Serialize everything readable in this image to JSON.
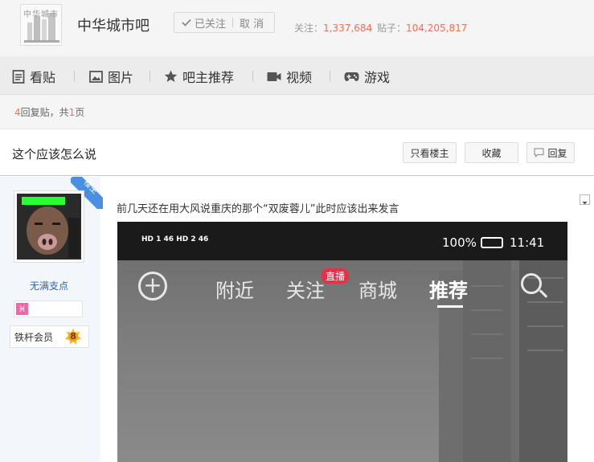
{
  "forum": {
    "logo_text": "中华城市",
    "name": "中华城市吧",
    "followed_label": "已关注",
    "unfollow_label": "取 消",
    "follow_label": "关注：",
    "follow_count": "1,337,684",
    "posts_label": "贴子：",
    "posts_count": "104,205,817"
  },
  "nav": [
    {
      "label": "看贴",
      "icon": "document-icon"
    },
    {
      "label": "图片",
      "icon": "image-icon"
    },
    {
      "label": "吧主推荐",
      "icon": "star-icon"
    },
    {
      "label": "视频",
      "icon": "video-camera-icon"
    },
    {
      "label": "游戏",
      "icon": "gamepad-icon"
    }
  ],
  "reply_info": {
    "count": "4",
    "text1": "回复贴，共",
    "pages": "1",
    "text2": "页"
  },
  "thread": {
    "title": "这个应该怎么说",
    "only_op_label": "只看楼主",
    "favorite_label": "收藏",
    "reply_label": "回复"
  },
  "author": {
    "badge": "楼主",
    "username": "无满支点",
    "member_label": "铁杆会员",
    "level": "8"
  },
  "post": {
    "text": "前几天还在用大风说重庆的那个“双废蓉儿”此时应该出来发言"
  },
  "screenshot": {
    "status_left": "HD 1 46 HD 2 46",
    "battery": "100%",
    "time": "11:41",
    "tabs": [
      "附近",
      "关注",
      "商城",
      "推荐"
    ],
    "live_badge": "直播"
  },
  "colors": {
    "accent": "#f4704f",
    "link": "#2d64b3",
    "badge": "#4a90e2"
  }
}
